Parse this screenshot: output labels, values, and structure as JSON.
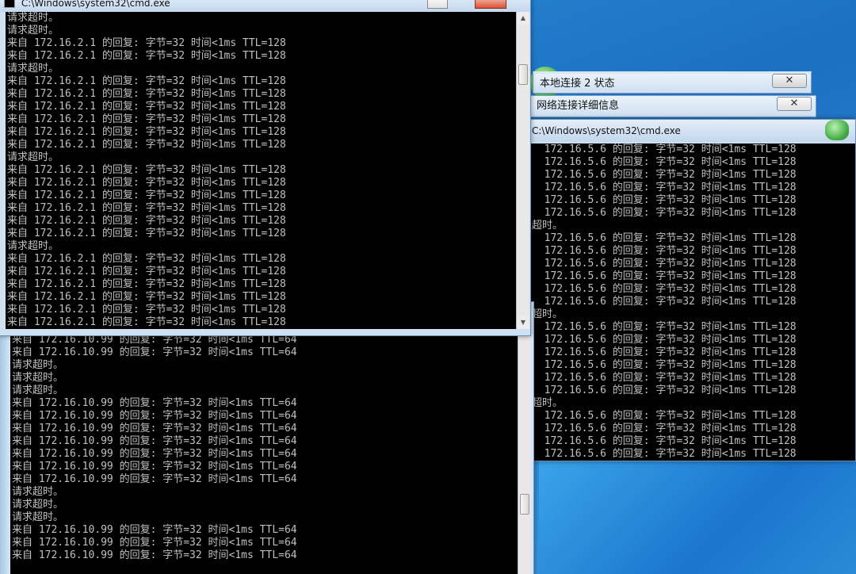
{
  "desktop": {
    "dialog1_title": "本地连接 2 状态",
    "dialog2_title": "网络连接详细信息",
    "close_glyph": "✕"
  },
  "cmd_main": {
    "title": "C:\\Windows\\system32\\cmd.exe",
    "lines": "请求超时。\n请求超时。\n来自 172.16.2.1 的回复: 字节=32 时间<1ms TTL=128\n来自 172.16.2.1 的回复: 字节=32 时间<1ms TTL=128\n请求超时。\n来自 172.16.2.1 的回复: 字节=32 时间<1ms TTL=128\n来自 172.16.2.1 的回复: 字节=32 时间<1ms TTL=128\n来自 172.16.2.1 的回复: 字节=32 时间<1ms TTL=128\n来自 172.16.2.1 的回复: 字节=32 时间<1ms TTL=128\n来自 172.16.2.1 的回复: 字节=32 时间<1ms TTL=128\n来自 172.16.2.1 的回复: 字节=32 时间<1ms TTL=128\n请求超时。\n来自 172.16.2.1 的回复: 字节=32 时间<1ms TTL=128\n来自 172.16.2.1 的回复: 字节=32 时间<1ms TTL=128\n来自 172.16.2.1 的回复: 字节=32 时间<1ms TTL=128\n来自 172.16.2.1 的回复: 字节=32 时间<1ms TTL=128\n来自 172.16.2.1 的回复: 字节=32 时间<1ms TTL=128\n来自 172.16.2.1 的回复: 字节=32 时间<1ms TTL=128\n请求超时。\n来自 172.16.2.1 的回复: 字节=32 时间<1ms TTL=128\n来自 172.16.2.1 的回复: 字节=32 时间<1ms TTL=128\n来自 172.16.2.1 的回复: 字节=32 时间<1ms TTL=128\n来自 172.16.2.1 的回复: 字节=32 时间<1ms TTL=128\n来自 172.16.2.1 的回复: 字节=32 时间<1ms TTL=128\n来自 172.16.2.1 的回复: 字节=32 时间<1ms TTL=128"
  },
  "cmd_bottom": {
    "lines": "来自 172.16.10.99 的回复: 字节=32 时间<1ms TTL=64\n来自 172.16.10.99 的回复: 字节=32 时间<1ms TTL=64\n请求超时。\n请求超时。\n请求超时。\n来自 172.16.10.99 的回复: 字节=32 时间<1ms TTL=64\n来自 172.16.10.99 的回复: 字节=32 时间<1ms TTL=64\n来自 172.16.10.99 的回复: 字节=32 时间<1ms TTL=64\n来自 172.16.10.99 的回复: 字节=32 时间<1ms TTL=64\n来自 172.16.10.99 的回复: 字节=32 时间<1ms TTL=64\n来自 172.16.10.99 的回复: 字节=32 时间<1ms TTL=64\n来自 172.16.10.99 的回复: 字节=32 时间<1ms TTL=64\n请求超时。\n请求超时。\n请求超时。\n来自 172.16.10.99 的回复: 字节=32 时间<1ms TTL=64\n来自 172.16.10.99 的回复: 字节=32 时间<1ms TTL=64\n来自 172.16.10.99 的回复: 字节=32 时间<1ms TTL=64"
  },
  "cmd_right": {
    "title": "C:\\Windows\\system32\\cmd.exe",
    "lines": "  172.16.5.6 的回复: 字节=32 时间<1ms TTL=128\n  172.16.5.6 的回复: 字节=32 时间<1ms TTL=128\n  172.16.5.6 的回复: 字节=32 时间<1ms TTL=128\n  172.16.5.6 的回复: 字节=32 时间<1ms TTL=128\n  172.16.5.6 的回复: 字节=32 时间<1ms TTL=128\n  172.16.5.6 的回复: 字节=32 时间<1ms TTL=128\n超时。\n  172.16.5.6 的回复: 字节=32 时间<1ms TTL=128\n  172.16.5.6 的回复: 字节=32 时间<1ms TTL=128\n  172.16.5.6 的回复: 字节=32 时间<1ms TTL=128\n  172.16.5.6 的回复: 字节=32 时间<1ms TTL=128\n  172.16.5.6 的回复: 字节=32 时间<1ms TTL=128\n  172.16.5.6 的回复: 字节=32 时间<1ms TTL=128\n超时。\n  172.16.5.6 的回复: 字节=32 时间<1ms TTL=128\n  172.16.5.6 的回复: 字节=32 时间<1ms TTL=128\n  172.16.5.6 的回复: 字节=32 时间<1ms TTL=128\n  172.16.5.6 的回复: 字节=32 时间<1ms TTL=128\n  172.16.5.6 的回复: 字节=32 时间<1ms TTL=128\n  172.16.5.6 的回复: 字节=32 时间<1ms TTL=128\n超时。\n  172.16.5.6 的回复: 字节=32 时间<1ms TTL=128\n  172.16.5.6 的回复: 字节=32 时间<1ms TTL=128\n  172.16.5.6 的回复: 字节=32 时间<1ms TTL=128\n  172.16.5.6 的回复: 字节=32 时间<1ms TTL=128"
  }
}
